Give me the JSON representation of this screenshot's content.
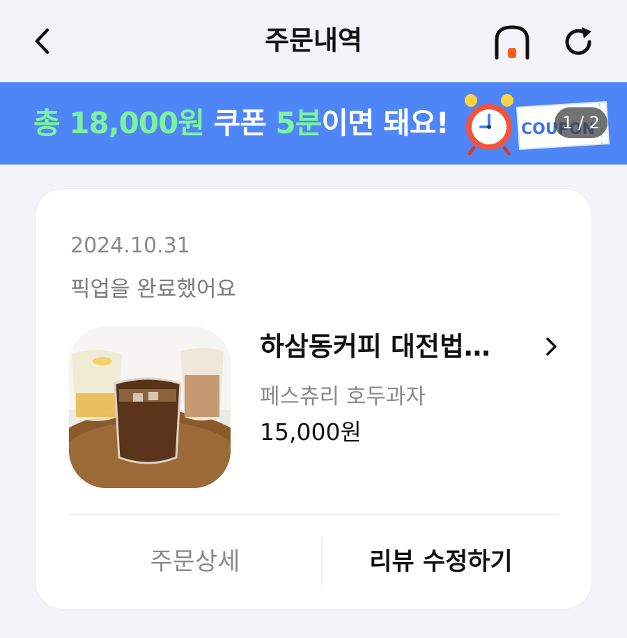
{
  "header": {
    "title": "주문내역",
    "back_icon": "chevron-left-icon",
    "home_icon": "home-icon",
    "refresh_icon": "refresh-icon",
    "home_dot_color": "#ff5a1f"
  },
  "banner": {
    "text_parts": [
      "총 18,000원",
      " 쿠폰 ",
      "5분",
      "이면 돼요!"
    ],
    "art_text": "COUPON",
    "counter": "1 / 2",
    "background_color": "#4f86f7",
    "highlight_color": "#7cf2a0"
  },
  "order": {
    "date": "2024.10.31",
    "status": "픽업을 완료했어요",
    "store_name": "하삼동커피 대전법…",
    "menu": "페스츄리 호두과자",
    "price": "15,000원",
    "detail_button": "주문상세",
    "review_button": "리뷰 수정하기"
  }
}
